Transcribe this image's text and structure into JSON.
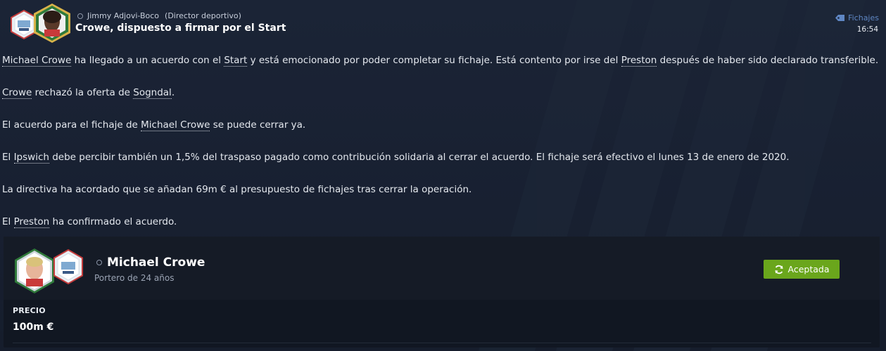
{
  "header": {
    "sender_name": "Jimmy Adjovi-Boco",
    "sender_role": "(Director deportivo)",
    "subject": "Crowe, dispuesto a firmar por el Start",
    "category": "Fichajes",
    "time": "16:54",
    "icons": [
      "club-badge",
      "person-badge",
      "person-icon",
      "tag-icon"
    ]
  },
  "body": {
    "p1": {
      "player": "Michael Crowe",
      "t1": " ha llegado a un acuerdo con el ",
      "club": "Start",
      "t2": " y está emocionado por poder completar su fichaje. Está contento por irse del ",
      "from_club": "Preston",
      "t3": " después de haber sido declarado transferible."
    },
    "p2": {
      "player": "Crowe",
      "t1": " rechazó la oferta de ",
      "club": "Sogndal",
      "t2": "."
    },
    "p3": {
      "t1": "El acuerdo para el fichaje de ",
      "player": "Michael Crowe",
      "t2": " se puede cerrar ya."
    },
    "p4": {
      "t1": "El ",
      "club": "Ipswich",
      "t2": " debe percibir también un 1,5% del traspaso pagado como contribución solidaria al cerrar el acuerdo. El fichaje será efectivo el lunes 13 de enero de 2020."
    },
    "p5": {
      "t1": "La directiva ha acordado que se añadan 69m € al presupuesto de fichajes tras cerrar la operación."
    },
    "p6": {
      "t1": "El ",
      "club": "Preston",
      "t2": " ha confirmado el acuerdo."
    }
  },
  "player_card": {
    "name": "Michael Crowe",
    "description": "Portero de 24 años",
    "status_button": "Aceptada",
    "price_label": "PRECIO",
    "price_value": "100m €"
  },
  "colors": {
    "background": "#1a2233",
    "accent_green": "#6aa61c",
    "category_blue": "#5f87c4"
  }
}
